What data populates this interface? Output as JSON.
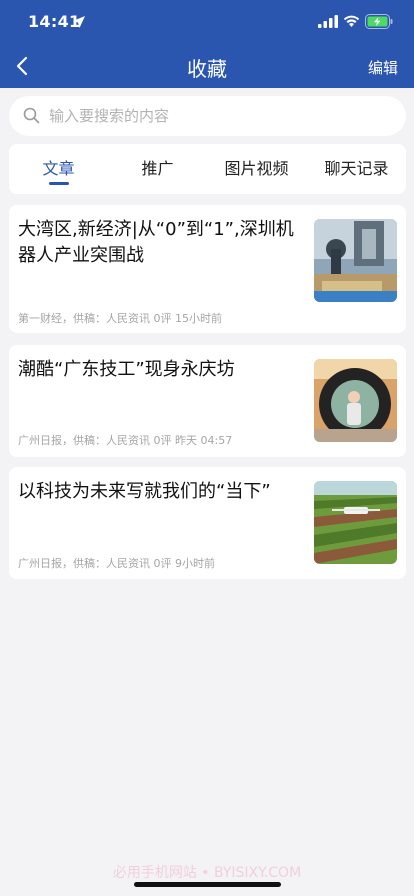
{
  "status": {
    "time": "14:41"
  },
  "nav": {
    "title": "收藏",
    "edit_label": "编辑"
  },
  "search": {
    "placeholder": "输入要搜索的内容"
  },
  "tabs": [
    {
      "label": "文章",
      "active": true
    },
    {
      "label": "推广",
      "active": false
    },
    {
      "label": "图片视频",
      "active": false
    },
    {
      "label": "聊天记录",
      "active": false
    }
  ],
  "articles": [
    {
      "title": "大湾区,新经济|从“0”到“1”,深圳机器人产业突围战",
      "meta": "第一财经，供稿：人民资讯 0评 15小时前",
      "thumb_icon": "robot-factory-image"
    },
    {
      "title": "潮酷“广东技工”现身永庆坊",
      "meta": "广州日报，供稿：人民资讯 0评 昨天 04:57",
      "thumb_icon": "tire-portrait-image"
    },
    {
      "title": "以科技为未来写就我们的“当下”",
      "meta": "广州日报，供稿：人民资讯 0评 9小时前",
      "thumb_icon": "drone-field-image"
    }
  ],
  "watermark": "必用手机网站 • BYISIXY.COM",
  "colors": {
    "brand": "#2b56b0",
    "background": "#f3f3f5"
  }
}
